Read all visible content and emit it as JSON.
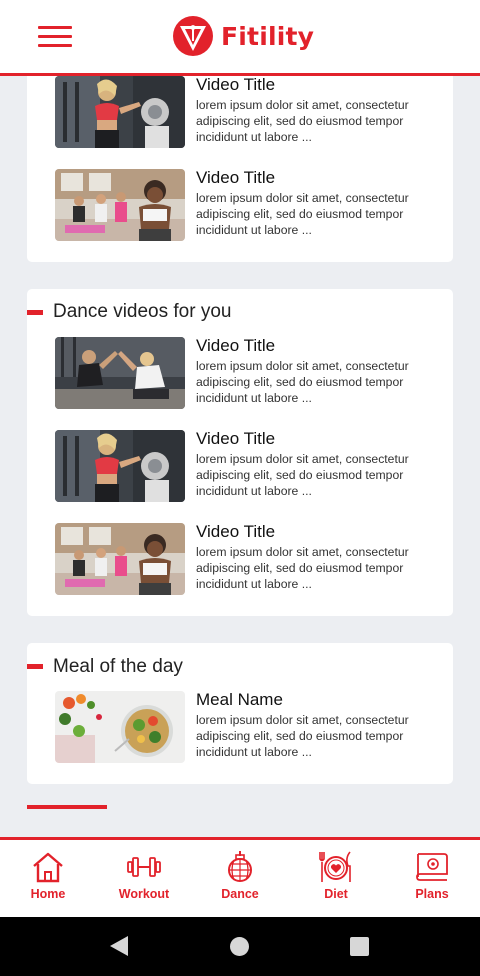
{
  "app": {
    "name": "Fitility"
  },
  "colors": {
    "accent": "#e2222b",
    "background": "#eceef2",
    "card": "#ffffff"
  },
  "top_card": {
    "items": [
      {
        "title": "Video Title",
        "description": "lorem ipsum dolor sit amet, consectetur adipiscing elit, sed do eiusmod tempor incididunt ut labore ...",
        "thumbnail": "gym-woman-red-top"
      },
      {
        "title": "Video Title",
        "description": "lorem ipsum dolor sit amet, consectetur adipiscing elit, sed do eiusmod tempor incididunt ut labore ...",
        "thumbnail": "yoga-class"
      }
    ]
  },
  "dance_section": {
    "title": "Dance videos for you",
    "items": [
      {
        "title": "Video Title",
        "description": "lorem ipsum dolor sit amet, consectetur adipiscing elit, sed do eiusmod tempor incididunt ut labore ...",
        "thumbnail": "high-five-workout"
      },
      {
        "title": "Video Title",
        "description": "lorem ipsum dolor sit amet, consectetur adipiscing elit, sed do eiusmod tempor incididunt ut labore ...",
        "thumbnail": "gym-woman-red-top"
      },
      {
        "title": "Video Title",
        "description": "lorem ipsum dolor sit amet, consectetur adipiscing elit, sed do eiusmod tempor incididunt ut labore ...",
        "thumbnail": "yoga-class"
      }
    ]
  },
  "meal_section": {
    "title": "Meal of the day",
    "items": [
      {
        "title": "Meal Name",
        "description": "lorem ipsum dolor sit amet, consectetur adipiscing elit, sed do eiusmod tempor incididunt ut labore ...",
        "thumbnail": "salad-bowl"
      }
    ]
  },
  "bottom_nav": {
    "items": [
      {
        "label": "Home",
        "icon": "home-icon"
      },
      {
        "label": "Workout",
        "icon": "dumbbell-icon"
      },
      {
        "label": "Dance",
        "icon": "disco-ball-icon"
      },
      {
        "label": "Diet",
        "icon": "plate-heart-icon"
      },
      {
        "label": "Plans",
        "icon": "plan-scroll-icon"
      }
    ]
  }
}
